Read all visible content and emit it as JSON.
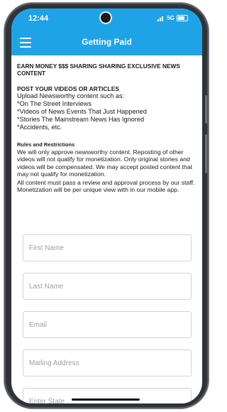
{
  "status_bar": {
    "time": "12:44",
    "network": "5G"
  },
  "app_bar": {
    "title": "Getting Paid",
    "menu_icon": "hamburger-menu-icon",
    "color": "#1fa3e7"
  },
  "content": {
    "heading": "EARN MONEY $$$ SHARING SHARING EXCLUSIVE NEWS CONTENT",
    "post_section": {
      "title": "POST YOUR VIDEOS OR ARTICLES",
      "lines": [
        "Upload Newsworthy content such as:",
        "*On The Street Interviews",
        "*Videos of News Events That Just Happened",
        "*Stories The Mainstream News Has Ignored",
        "*Accidents, etc."
      ]
    },
    "rules_section": {
      "title": "Rules and Restrictions",
      "text": "We will only approve newsworthy content.  Reposting of other videos will not qualify for monetization.  Only original stories and videos will be compensated. We may accept posted content that may not qualify for monetization.",
      "text2": "All content must pass a review and approval process by our staff.  Monetization will be per unique view with in our mobile app."
    }
  },
  "form": {
    "first_name": {
      "placeholder": "First Name",
      "value": ""
    },
    "last_name": {
      "placeholder": "Last Name",
      "value": ""
    },
    "email": {
      "placeholder": "Email",
      "value": ""
    },
    "mailing_address": {
      "placeholder": "Mailing Address",
      "value": ""
    },
    "state": {
      "placeholder": "Enter State",
      "value": ""
    }
  }
}
